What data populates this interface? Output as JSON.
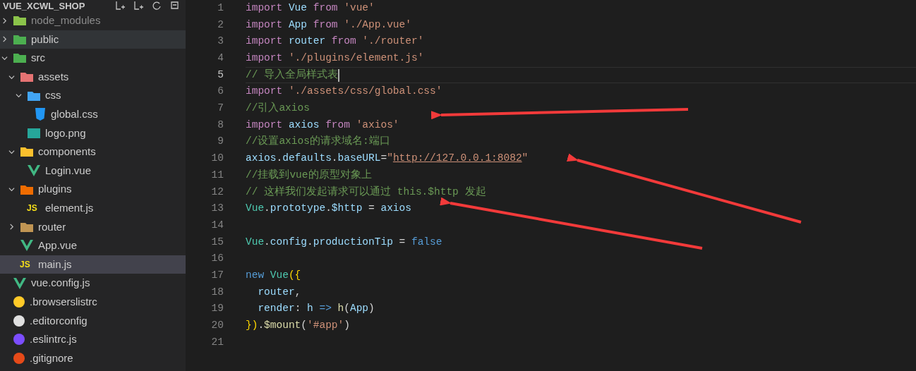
{
  "explorer": {
    "title": "VUE_XCWL_SHOP",
    "tree": [
      {
        "name": "node_modules",
        "kind": "node",
        "expanded": false,
        "dimmed": true,
        "selected": false,
        "hovered": false
      },
      {
        "name": "public",
        "kind": "public",
        "expanded": false,
        "dimmed": false,
        "selected": false,
        "hovered": true
      },
      {
        "name": "src",
        "kind": "src",
        "expanded": true,
        "dimmed": false,
        "selected": false,
        "hovered": false,
        "children": [
          {
            "name": "assets",
            "kind": "assets",
            "expanded": true,
            "dimmed": false,
            "selected": false,
            "hovered": false,
            "children": [
              {
                "name": "css",
                "kind": "css-folder",
                "expanded": true,
                "dimmed": false,
                "selected": false,
                "hovered": false,
                "children": [
                  {
                    "name": "global.css",
                    "kind": "css",
                    "dimmed": false,
                    "selected": false,
                    "hovered": false
                  }
                ]
              },
              {
                "name": "logo.png",
                "kind": "image",
                "dimmed": false,
                "selected": false,
                "hovered": false
              }
            ]
          },
          {
            "name": "components",
            "kind": "components",
            "expanded": true,
            "dimmed": false,
            "selected": false,
            "hovered": false,
            "children": [
              {
                "name": "Login.vue",
                "kind": "vue",
                "dimmed": false,
                "selected": false,
                "hovered": false
              }
            ]
          },
          {
            "name": "plugins",
            "kind": "plugins",
            "expanded": true,
            "dimmed": false,
            "selected": false,
            "hovered": false,
            "children": [
              {
                "name": "element.js",
                "kind": "js",
                "icon_text": "JS",
                "dimmed": false,
                "selected": false,
                "hovered": false
              }
            ]
          },
          {
            "name": "router",
            "kind": "folder",
            "expanded": false,
            "dimmed": false,
            "selected": false,
            "hovered": false
          },
          {
            "name": "App.vue",
            "kind": "vue",
            "dimmed": false,
            "selected": false,
            "hovered": false
          },
          {
            "name": "main.js",
            "kind": "js",
            "icon_text": "JS",
            "dimmed": false,
            "selected": true
          }
        ]
      },
      {
        "name": "vue.config.js",
        "kind": "vue-config",
        "dimmed": false,
        "selected": false,
        "hovered": false
      },
      {
        "name": ".browserslistrc",
        "kind": "browserslist",
        "dimmed": false,
        "selected": false,
        "hovered": false
      },
      {
        "name": ".editorconfig",
        "kind": "editorconfig",
        "dimmed": false,
        "selected": false,
        "hovered": false
      },
      {
        "name": ".eslintrc.js",
        "kind": "eslint",
        "dimmed": false,
        "selected": false,
        "hovered": false
      },
      {
        "name": ".gitignore",
        "kind": "git",
        "dimmed": false,
        "selected": false,
        "hovered": false
      }
    ]
  },
  "editor": {
    "lines": [
      {
        "n": "1",
        "current": false,
        "tokens": [
          {
            "kind": "keyword",
            "t": "import "
          },
          {
            "kind": "var",
            "t": "Vue "
          },
          {
            "kind": "keyword",
            "t": "from "
          },
          {
            "kind": "string",
            "t": "'vue'"
          }
        ]
      },
      {
        "n": "2",
        "current": false,
        "tokens": [
          {
            "kind": "keyword",
            "t": "import "
          },
          {
            "kind": "var",
            "t": "App "
          },
          {
            "kind": "keyword",
            "t": "from "
          },
          {
            "kind": "string",
            "t": "'./App.vue'"
          }
        ]
      },
      {
        "n": "3",
        "current": false,
        "tokens": [
          {
            "kind": "keyword",
            "t": "import "
          },
          {
            "kind": "var",
            "t": "router "
          },
          {
            "kind": "keyword",
            "t": "from "
          },
          {
            "kind": "string",
            "t": "'./router'"
          }
        ]
      },
      {
        "n": "4",
        "current": false,
        "tokens": [
          {
            "kind": "keyword",
            "t": "import "
          },
          {
            "kind": "string",
            "t": "'./plugins/element.js'"
          }
        ]
      },
      {
        "n": "5",
        "current": true,
        "tokens": [
          {
            "kind": "comment",
            "t": "// 导入全局样式表"
          }
        ]
      },
      {
        "n": "6",
        "current": false,
        "tokens": [
          {
            "kind": "keyword",
            "t": "import "
          },
          {
            "kind": "string",
            "t": "'./assets/css/global.css'"
          }
        ]
      },
      {
        "n": "7",
        "current": false,
        "tokens": [
          {
            "kind": "comment",
            "t": "//引入axios"
          }
        ]
      },
      {
        "n": "8",
        "current": false,
        "tokens": [
          {
            "kind": "keyword",
            "t": "import "
          },
          {
            "kind": "var",
            "t": "axios "
          },
          {
            "kind": "keyword",
            "t": "from "
          },
          {
            "kind": "string",
            "t": "'axios'"
          }
        ]
      },
      {
        "n": "9",
        "current": false,
        "tokens": [
          {
            "kind": "comment",
            "t": "//设置axios的请求域名:端口"
          }
        ]
      },
      {
        "n": "10",
        "current": false,
        "tokens": [
          {
            "kind": "var",
            "t": "axios"
          },
          {
            "kind": "plain",
            "t": "."
          },
          {
            "kind": "var",
            "t": "defaults"
          },
          {
            "kind": "plain",
            "t": "."
          },
          {
            "kind": "var",
            "t": "baseURL"
          },
          {
            "kind": "plain",
            "t": "="
          },
          {
            "kind": "string",
            "t": "\""
          },
          {
            "kind": "link",
            "t": "http://127.0.0.1:8082"
          },
          {
            "kind": "string",
            "t": "\""
          }
        ]
      },
      {
        "n": "11",
        "current": false,
        "tokens": [
          {
            "kind": "comment",
            "t": "//挂载到vue的原型对象上"
          }
        ]
      },
      {
        "n": "12",
        "current": false,
        "tokens": [
          {
            "kind": "comment",
            "t": "// 这样我们发起请求可以通过 this.$http 发起"
          }
        ]
      },
      {
        "n": "13",
        "current": false,
        "tokens": [
          {
            "kind": "class",
            "t": "Vue"
          },
          {
            "kind": "plain",
            "t": "."
          },
          {
            "kind": "var",
            "t": "prototype"
          },
          {
            "kind": "plain",
            "t": "."
          },
          {
            "kind": "var",
            "t": "$http"
          },
          {
            "kind": "plain",
            "t": " = "
          },
          {
            "kind": "var",
            "t": "axios"
          }
        ]
      },
      {
        "n": "14",
        "current": false
      },
      {
        "n": "15",
        "current": false,
        "tokens": [
          {
            "kind": "class",
            "t": "Vue"
          },
          {
            "kind": "plain",
            "t": "."
          },
          {
            "kind": "var",
            "t": "config"
          },
          {
            "kind": "plain",
            "t": "."
          },
          {
            "kind": "var",
            "t": "productionTip"
          },
          {
            "kind": "plain",
            "t": " = "
          },
          {
            "kind": "bool",
            "t": "false"
          }
        ]
      },
      {
        "n": "16",
        "current": false
      },
      {
        "n": "17",
        "current": false,
        "tokens": [
          {
            "kind": "bool",
            "t": "new "
          },
          {
            "kind": "class",
            "t": "Vue"
          },
          {
            "kind": "bracket",
            "t": "({"
          }
        ]
      },
      {
        "n": "18",
        "current": false,
        "tokens": [
          {
            "kind": "var",
            "t": "  router"
          },
          {
            "kind": "plain",
            "t": ","
          }
        ]
      },
      {
        "n": "19",
        "current": false,
        "tokens": [
          {
            "kind": "var",
            "t": "  render"
          },
          {
            "kind": "plain",
            "t": ": "
          },
          {
            "kind": "var",
            "t": "h "
          },
          {
            "kind": "bool",
            "t": "=> "
          },
          {
            "kind": "func",
            "t": "h"
          },
          {
            "kind": "plain",
            "t": "("
          },
          {
            "kind": "var",
            "t": "App"
          },
          {
            "kind": "plain",
            "t": ")"
          }
        ]
      },
      {
        "n": "20",
        "current": false,
        "tokens": [
          {
            "kind": "bracket",
            "t": "})"
          },
          {
            "kind": "plain",
            "t": "."
          },
          {
            "kind": "func",
            "t": "$mount"
          },
          {
            "kind": "plain",
            "t": "("
          },
          {
            "kind": "string",
            "t": "'#app'"
          },
          {
            "kind": "plain",
            "t": ")"
          }
        ]
      },
      {
        "n": "21",
        "current": false
      }
    ]
  }
}
